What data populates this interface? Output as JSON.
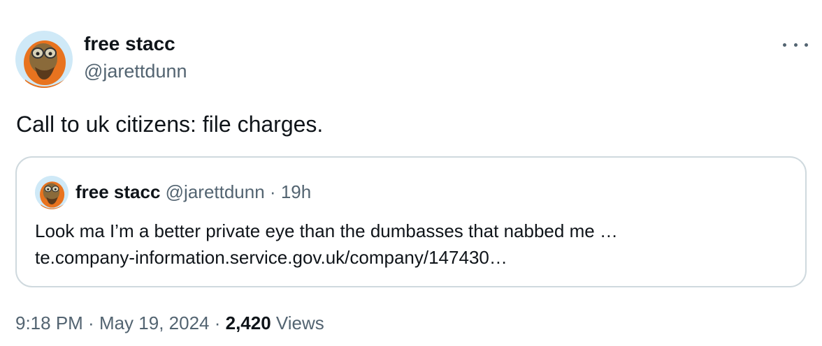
{
  "tweet": {
    "author": {
      "display_name": "free stacc",
      "handle": "@jarettdunn"
    },
    "text": "Call to uk citizens: file charges.",
    "more_icon": "more-horizontal-icon",
    "quote": {
      "author": {
        "display_name": "free stacc",
        "handle": "@jarettdunn"
      },
      "separator": " · ",
      "time": "19h",
      "line1": "Look ma I’m a better private eye than the dumbasses that nabbed me …",
      "line2": "te.company-information.service.gov.uk/company/147430…"
    },
    "footer": {
      "time": "9:18 PM",
      "sep1": " · ",
      "date": "May 19, 2024",
      "sep2": " · ",
      "views_count": "2,420",
      "views_label": " Views"
    }
  },
  "colors": {
    "text_primary": "#0f1419",
    "text_secondary": "#536471",
    "border": "#cfd9de",
    "avatar_bg": "#cfe9f7",
    "avatar_orange": "#e8731f"
  }
}
